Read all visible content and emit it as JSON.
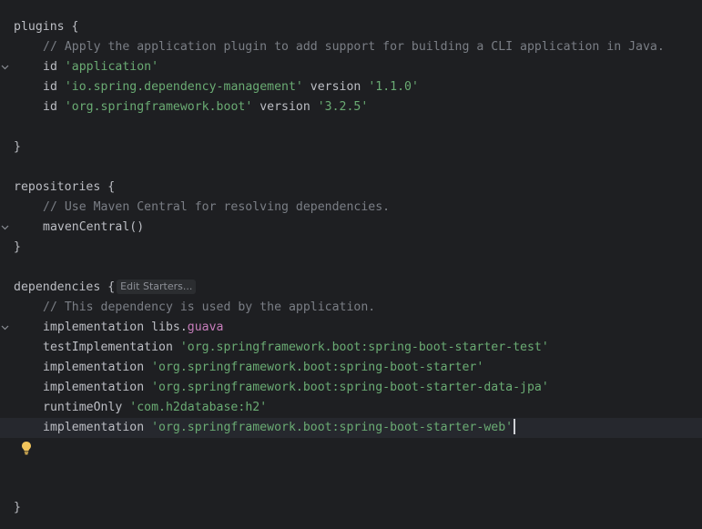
{
  "editor": {
    "lines": {
      "plugins_open": {
        "name": "plugins",
        "brace": " {"
      },
      "plugins_comment": "// Apply the application plugin to add support for building a CLI application in Java.",
      "plugin_app": {
        "kw": "id ",
        "str": "'application'"
      },
      "plugin_dm": {
        "kw": "id ",
        "str": "'io.spring.dependency-management'",
        "kw2": " version ",
        "ver": "'1.1.0'"
      },
      "plugin_boot": {
        "kw": "id ",
        "str": "'org.springframework.boot'",
        "kw2": " version ",
        "ver": "'3.2.5'"
      },
      "plugins_close": "}",
      "repos_open": {
        "name": "repositories",
        "brace": " {"
      },
      "repos_comment": "// Use Maven Central for resolving dependencies.",
      "repos_maven": "mavenCentral()",
      "repos_close": "}",
      "deps_open": {
        "name": "dependencies",
        "brace": " {"
      },
      "deps_hint": "Edit Starters...",
      "deps_comment": "// This dependency is used by the application.",
      "dep_guava": {
        "kw": "implementation ",
        "obj": "libs.",
        "prop": "guava"
      },
      "dep_test": {
        "kw": "testImplementation ",
        "str": "'org.springframework.boot:spring-boot-starter-test'"
      },
      "dep_starter": {
        "kw": "implementation ",
        "str": "'org.springframework.boot:spring-boot-starter'"
      },
      "dep_jpa": {
        "kw": "implementation ",
        "str": "'org.springframework.boot:spring-boot-starter-data-jpa'"
      },
      "dep_h2": {
        "kw": "runtimeOnly ",
        "str": "'com.h2database:h2'"
      },
      "dep_web": {
        "kw": "implementation ",
        "str": "'org.springframework.boot:spring-boot-starter-web'"
      },
      "deps_close": "}"
    },
    "icons": {
      "fold": "chevron-down-icon",
      "intention": "lightbulb-icon"
    },
    "colors": {
      "background": "#1e1f22",
      "current_line": "#26282e",
      "text": "#bcbec4",
      "string": "#6aab73",
      "comment": "#7a7e85",
      "property": "#c77dbb",
      "bulb": "#f2c55c"
    }
  }
}
